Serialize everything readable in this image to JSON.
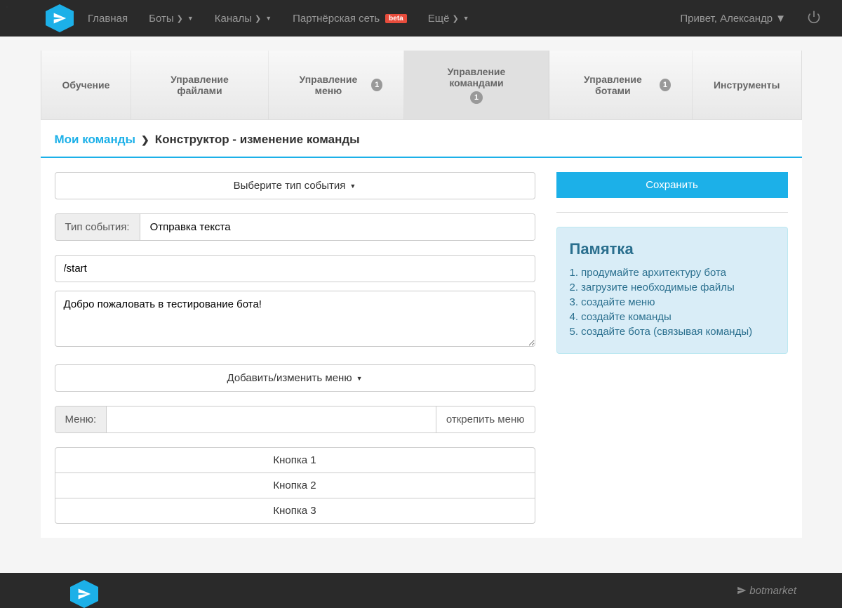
{
  "nav": {
    "home": "Главная",
    "bots": "Боты",
    "channels": "Каналы",
    "partner": "Партнёрская сеть",
    "partner_badge": "beta",
    "more": "Ещё"
  },
  "user": {
    "greeting": "Привет, Александр"
  },
  "tabs": {
    "training": "Обучение",
    "files": "Управление файлами",
    "menu": "Управление меню",
    "menu_badge": "1",
    "commands": "Управление командами",
    "commands_badge": "1",
    "bots": "Управление ботами",
    "bots_badge": "1",
    "tools": "Инструменты"
  },
  "breadcrumb": {
    "link": "Мои команды",
    "current": "Конструктор - изменение команды"
  },
  "form": {
    "event_type_dropdown": "Выберите тип события",
    "event_type_label": "Тип события:",
    "event_type_value": "Отправка текста",
    "command_input": "/start",
    "message_textarea": "Добро пожаловать в тестирование бота!",
    "menu_dropdown": "Добавить/изменить меню",
    "menu_label": "Меню:",
    "menu_value": "",
    "menu_detach": "открепить меню",
    "buttons": [
      "Кнопка 1",
      "Кнопка 2",
      "Кнопка 3"
    ]
  },
  "sidebar": {
    "save": "Сохранить",
    "hint_title": "Памятка",
    "hints": [
      "1. продумайте архитектуру бота",
      "2. загрузите необходимые файлы",
      "3. создайте меню",
      "4. создайте команды",
      "5. создайте бота (связывая команды)"
    ]
  },
  "footer": {
    "brand": "botmarket"
  }
}
